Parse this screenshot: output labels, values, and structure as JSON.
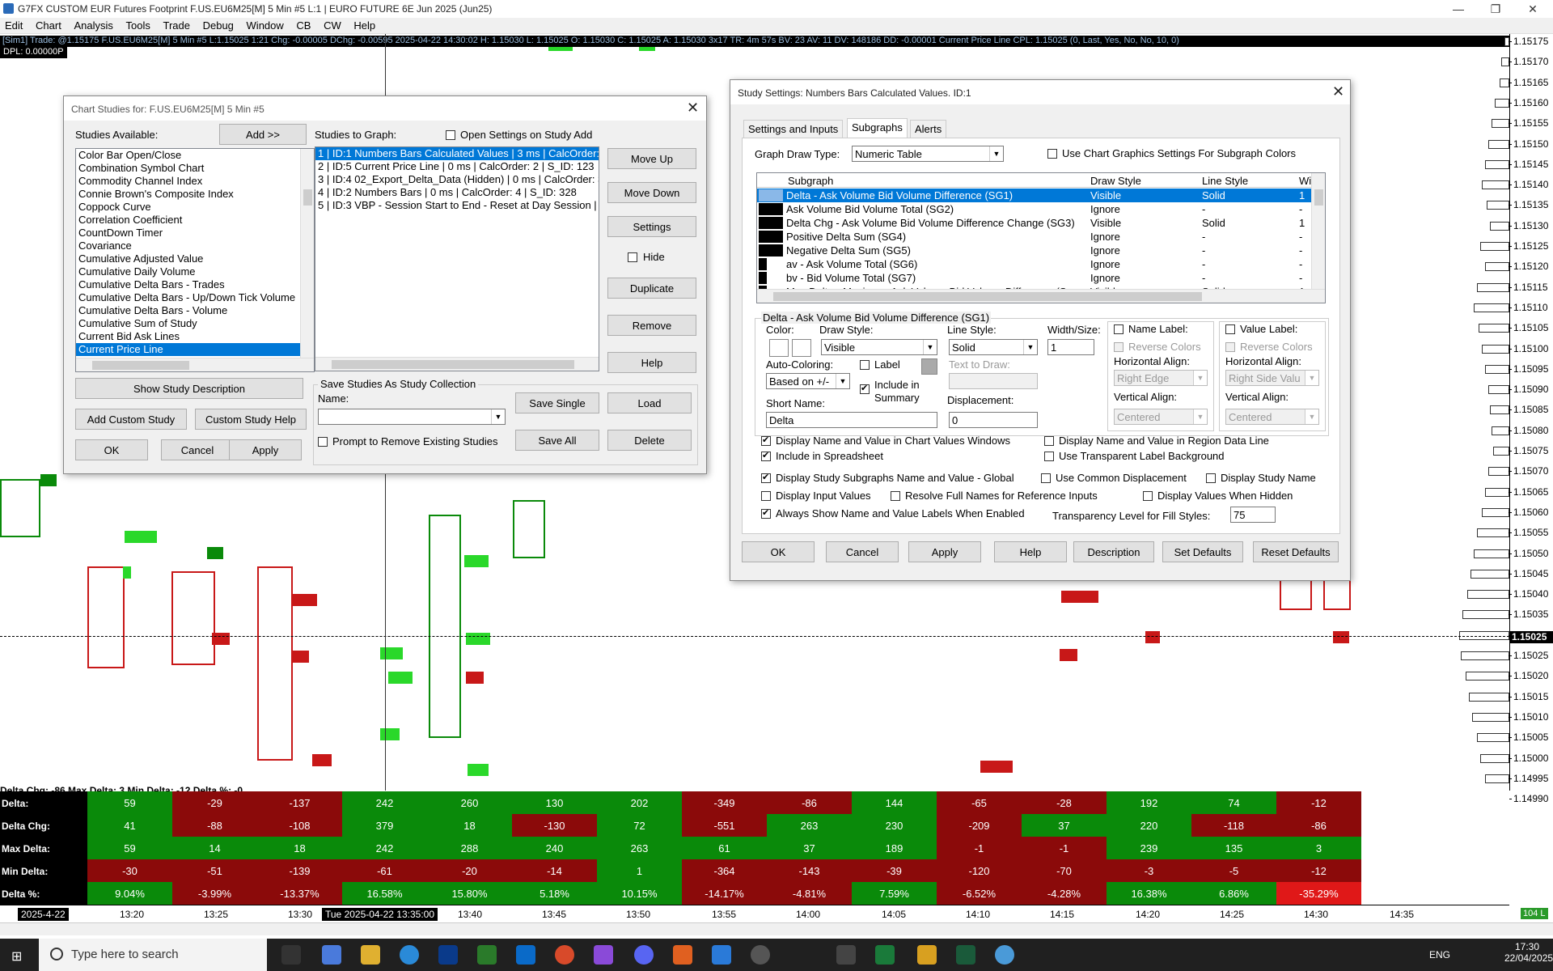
{
  "window": {
    "title": "G7FX CUSTOM EUR Futures Footprint F.US.EU6M25[M]  5 Min  #5 L:1 | EURO FUTURE 6E Jun 2025 (Jun25)",
    "minimize": "—",
    "restore": "❐",
    "close": "✕"
  },
  "menu": [
    "Edit",
    "Chart",
    "Analysis",
    "Tools",
    "Trade",
    "Debug",
    "Window",
    "CB",
    "CW",
    "Help"
  ],
  "chart": {
    "info_line": "[Sim1]  Trade: @1.15175   F.US.EU6M25[M]  5 Min  #5   L:1.15025   1:21   Chg: -0.00005   DChg: -0.00595   2025-04-22 14:30:02  H: 1.15030  L: 1.15025  O: 1.15030  C: 1.15025  A: 1.15030  3x17  TR: 4m 57s  BV: 23  AV: 11  DV: 148186  DD: -0.00001   Current Price Line   CPL: 1.15025   (0, Last, Yes, No, No, 10, 0)",
    "dpl": "DPL: 0.00000P",
    "current_price": "1.15025",
    "price_ticks": [
      "1.15175",
      "1.15170",
      "1.15165",
      "1.15160",
      "1.15155",
      "1.15150",
      "1.15145",
      "1.15140",
      "1.15135",
      "1.15130",
      "1.15125",
      "1.15120",
      "1.15115",
      "1.15110",
      "1.15105",
      "1.15100",
      "1.15095",
      "1.15090",
      "1.15085",
      "1.15080",
      "1.15075",
      "1.15070",
      "1.15065",
      "1.15060",
      "1.15055",
      "1.15050",
      "1.15045",
      "1.15040",
      "1.15035",
      "1.15030",
      "1.15025",
      "1.15020",
      "1.15015",
      "1.15010",
      "1.15005",
      "1.15000",
      "1.14995",
      "1.14990"
    ],
    "stats_line": "Delta Chg: -86  Max Delta: 3  Min Delta: -12  Delta %: -0",
    "time_labels": [
      "13:20",
      "13:25",
      "13:30",
      "13:40",
      "13:45",
      "13:50",
      "13:55",
      "14:00",
      "14:05",
      "14:10",
      "14:15",
      "14:20",
      "14:25",
      "14:30",
      "14:35"
    ],
    "date_left": "2025-4-22",
    "time_selected": "Tue 2025-04-22  13:35:00",
    "ta_right": "104 L"
  },
  "table": {
    "rows": [
      {
        "label": "Delta:",
        "values": [
          "59",
          "-29",
          "-137",
          "242",
          "260",
          "130",
          "202",
          "-349",
          "-86",
          "144",
          "-65",
          "-28",
          "192",
          "74",
          "-12"
        ]
      },
      {
        "label": "Delta Chg:",
        "values": [
          "41",
          "-88",
          "-108",
          "379",
          "18",
          "-130",
          "72",
          "-551",
          "263",
          "230",
          "-209",
          "37",
          "220",
          "-118",
          "-86"
        ]
      },
      {
        "label": "Max Delta:",
        "values": [
          "59",
          "14",
          "18",
          "242",
          "288",
          "240",
          "263",
          "61",
          "37",
          "189",
          "-1",
          "-1",
          "239",
          "135",
          "3"
        ]
      },
      {
        "label": "Min Delta:",
        "values": [
          "-30",
          "-51",
          "-139",
          "-61",
          "-20",
          "-14",
          "1",
          "-364",
          "-143",
          "-39",
          "-120",
          "-70",
          "-3",
          "-5",
          "-12"
        ]
      },
      {
        "label": "Delta %:",
        "values": [
          "9.04%",
          "-3.99%",
          "-13.37%",
          "16.58%",
          "15.80%",
          "5.18%",
          "10.15%",
          "-14.17%",
          "-4.81%",
          "7.59%",
          "-6.52%",
          "-4.28%",
          "16.38%",
          "6.86%",
          "-35.29%"
        ]
      }
    ],
    "colors": {
      "Delta:": [
        "g",
        "r",
        "r",
        "g",
        "g",
        "g",
        "g",
        "r",
        "r",
        "g",
        "r",
        "r",
        "g",
        "g",
        "r"
      ],
      "Delta Chg:": [
        "g",
        "r",
        "r",
        "g",
        "g",
        "r",
        "g",
        "r",
        "g",
        "g",
        "r",
        "g",
        "g",
        "r",
        "r"
      ],
      "Max Delta:": [
        "g",
        "g",
        "g",
        "g",
        "g",
        "g",
        "g",
        "g",
        "g",
        "g",
        "r",
        "r",
        "g",
        "g",
        "g"
      ],
      "Min Delta:": [
        "r",
        "r",
        "r",
        "r",
        "r",
        "r",
        "g",
        "r",
        "r",
        "r",
        "r",
        "r",
        "r",
        "r",
        "r"
      ],
      "Delta %:": [
        "g",
        "r",
        "r",
        "g",
        "g",
        "g",
        "g",
        "r",
        "r",
        "g",
        "r",
        "r",
        "g",
        "g",
        "rb"
      ]
    },
    "green": "#0a8a0a",
    "red": "#8b0a0a",
    "bright_red": "#e01818"
  },
  "studies_dialog": {
    "title": "Chart Studies for: F.US.EU6M25[M]  5 Min  #5",
    "available_label": "Studies Available:",
    "add_button": "Add >>",
    "available": [
      "Color Bar Open/Close",
      "Combination Symbol Chart",
      "Commodity Channel Index",
      "Connie Brown's Composite Index",
      "Coppock Curve",
      "Correlation Coefficient",
      "CountDown Timer",
      "Covariance",
      "Cumulative Adjusted Value",
      "Cumulative Daily Volume",
      "Cumulative Delta Bars - Trades",
      "Cumulative Delta Bars - Up/Down Tick Volume",
      "Cumulative Delta Bars - Volume",
      "Cumulative Sum of Study",
      "Current Bid Ask Lines",
      "Current Price Line"
    ],
    "to_graph_label": "Studies to Graph:",
    "open_settings_label": "Open Settings on Study Add",
    "to_graph": [
      "1 | ID:1  Numbers Bars Calculated Values | 3 ms | CalcOrder: 1 |",
      "2 | ID:5  Current Price Line | 0 ms | CalcOrder: 2 | S_ID: 123",
      "3 | ID:4  02_Export_Delta_Data (Hidden) | 0 ms | CalcOrder: 3",
      "4 | ID:2  Numbers Bars | 0 ms | CalcOrder: 4 | S_ID: 328",
      "5 | ID:3  VBP - Session Start to End - Reset at Day Session |"
    ],
    "move_up": "Move Up",
    "move_down": "Move Down",
    "settings": "Settings",
    "hide": "Hide",
    "duplicate": "Duplicate",
    "remove": "Remove",
    "help": "Help",
    "show_desc": "Show Study Description",
    "add_custom": "Add Custom Study",
    "custom_help": "Custom Study Help",
    "save_group": "Save Studies As Study Collection",
    "name_label": "Name:",
    "save_single": "Save Single",
    "load": "Load",
    "save_all": "Save All",
    "delete": "Delete",
    "prompt_remove": "Prompt to Remove Existing Studies",
    "ok": "OK",
    "cancel": "Cancel",
    "apply": "Apply",
    "close": "✕"
  },
  "settings_dialog": {
    "title": "Study Settings: Numbers Bars Calculated Values. ID:1",
    "tabs": [
      "Settings and Inputs",
      "Subgraphs",
      "Alerts"
    ],
    "graph_draw_type_label": "Graph Draw Type:",
    "graph_draw_type": "Numeric Table",
    "use_chart_graphics": "Use Chart Graphics Settings For Subgraph Colors",
    "columns": [
      "Subgraph",
      "Draw Style",
      "Line Style",
      "Wi"
    ],
    "subgraphs": [
      {
        "name": "Delta - Ask Volume Bid Volume Difference (SG1)",
        "draw": "Visible",
        "line": "Solid",
        "w": "1"
      },
      {
        "name": "Ask Volume Bid Volume Total (SG2)",
        "draw": "Ignore",
        "line": "-",
        "w": "-"
      },
      {
        "name": "Delta Chg - Ask Volume Bid Volume Difference Change (SG3)",
        "draw": "Visible",
        "line": "Solid",
        "w": "1"
      },
      {
        "name": "Positive Delta Sum (SG4)",
        "draw": "Ignore",
        "line": "-",
        "w": "-"
      },
      {
        "name": "Negative Delta Sum (SG5)",
        "draw": "Ignore",
        "line": "-",
        "w": "-"
      },
      {
        "name": "av - Ask Volume Total (SG6)",
        "draw": "Ignore",
        "line": "-",
        "w": "-"
      },
      {
        "name": "bv - Bid Volume Total (SG7)",
        "draw": "Ignore",
        "line": "-",
        "w": "-"
      },
      {
        "name": "Max Delta - Maximum Ask Volume Bid Volume Difference (S",
        "draw": "Visible",
        "line": "Solid",
        "w": "1"
      }
    ],
    "group_title": "Delta - Ask Volume Bid Volume Difference (SG1)",
    "color_label": "Color:",
    "draw_style_label": "Draw Style:",
    "draw_style": "Visible",
    "line_style_label": "Line Style:",
    "line_style": "Solid",
    "width_label": "Width/Size:",
    "width": "1",
    "auto_coloring_label": "Auto-Coloring:",
    "auto_coloring": "Based on +/-",
    "label_chk": "Label",
    "include_summary": "Include in Summary",
    "text_to_draw": "Text to Draw:",
    "short_name_label": "Short Name:",
    "short_name": "Delta",
    "displacement_label": "Displacement:",
    "displacement": "0",
    "name_label_chk": "Name Label:",
    "value_label_chk": "Value Label:",
    "reverse_colors": "Reverse Colors",
    "h_align": "Horizontal Align:",
    "v_align": "Vertical Align:",
    "right_edge": "Right Edge",
    "right_side": "Right Side Valu",
    "centered": "Centered",
    "display_name_chart": "Display Name and Value in Chart Values Windows",
    "display_name_region": "Display Name and Value in Region Data Line",
    "include_spreadsheet": "Include in Spreadsheet",
    "transparent_label": "Use Transparent Label Background",
    "display_subgraphs_global": "Display Study Subgraphs Name and Value - Global",
    "common_disp": "Use Common Displacement",
    "display_study_name": "Display Study Name",
    "display_input_values": "Display Input Values",
    "resolve_full": "Resolve Full Names for Reference Inputs",
    "display_hidden": "Display Values When Hidden",
    "always_show": "Always Show Name and Value Labels When Enabled",
    "transparency_label": "Transparency Level for Fill Styles:",
    "transparency": "75",
    "ok": "OK",
    "cancel": "Cancel",
    "apply": "Apply",
    "help": "Help",
    "description": "Description",
    "set_defaults": "Set Defaults",
    "reset_defaults": "Reset Defaults",
    "close": "✕"
  },
  "taskbar": {
    "search_placeholder": "Type here to search",
    "lang": "ENG",
    "time": "17:30",
    "date": "22/04/2025"
  }
}
